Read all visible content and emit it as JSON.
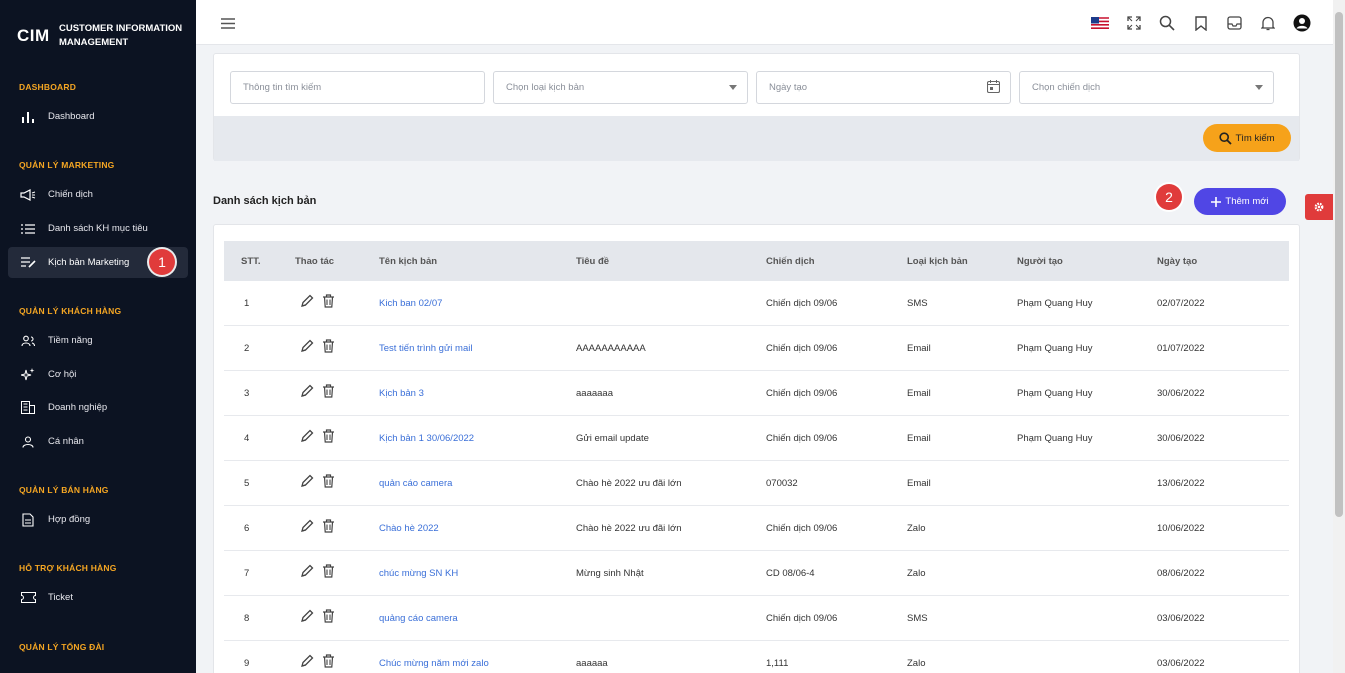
{
  "brand": {
    "mark": "CIM",
    "line1": "CUSTOMER INFORMATION",
    "line2": "MANAGEMENT"
  },
  "sidebar": {
    "sections": [
      {
        "title": "DASHBOARD",
        "items": [
          {
            "label": "Dashboard",
            "icon": "bar-chart-icon"
          }
        ]
      },
      {
        "title": "QUẢN LÝ MARKETING",
        "items": [
          {
            "label": "Chiến dịch",
            "icon": "megaphone-icon"
          },
          {
            "label": "Danh sách KH mục tiêu",
            "icon": "list-icon"
          },
          {
            "label": "Kịch bản Marketing",
            "icon": "edit-list-icon",
            "active": true
          }
        ]
      },
      {
        "title": "QUẢN LÝ KHÁCH HÀNG",
        "items": [
          {
            "label": "Tiềm năng",
            "icon": "users-icon"
          },
          {
            "label": "Cơ hội",
            "icon": "sparkle-icon"
          },
          {
            "label": "Doanh nghiệp",
            "icon": "building-icon"
          },
          {
            "label": "Cá nhân",
            "icon": "user-icon"
          }
        ]
      },
      {
        "title": "QUẢN LÝ BÁN HÀNG",
        "items": [
          {
            "label": "Hợp đồng",
            "icon": "document-icon"
          }
        ]
      },
      {
        "title": "HỖ TRỢ KHÁCH HÀNG",
        "items": [
          {
            "label": "Ticket",
            "icon": "ticket-icon"
          }
        ]
      },
      {
        "title": "QUẢN LÝ TỔNG ĐÀI",
        "items": []
      }
    ]
  },
  "callouts": {
    "one": "1",
    "two": "2"
  },
  "filters": {
    "search_placeholder": "Thông tin tìm kiếm",
    "type_placeholder": "Chọn loại kịch bản",
    "date_placeholder": "Ngày tạo",
    "campaign_placeholder": "Chọn chiến dịch",
    "search_button": "Tìm kiếm"
  },
  "list": {
    "title": "Danh sách kịch bản",
    "add_button": "Thêm mới"
  },
  "table": {
    "headers": [
      "STT.",
      "Thao tác",
      "Tên kịch bản",
      "Tiêu đề",
      "Chiến dịch",
      "Loại kịch bản",
      "Người tạo",
      "Ngày tạo"
    ],
    "rows": [
      {
        "stt": "1",
        "name": "Kich ban 02/07",
        "title": "",
        "campaign": "Chiến dịch 09/06",
        "type": "SMS",
        "creator": "Phạm Quang Huy",
        "date": "02/07/2022"
      },
      {
        "stt": "2",
        "name": "Test tiến trình gửi mail",
        "title": "AAAAAAAAAAA",
        "campaign": "Chiến dịch 09/06",
        "type": "Email",
        "creator": "Phạm Quang Huy",
        "date": "01/07/2022"
      },
      {
        "stt": "3",
        "name": "Kịch bản 3",
        "title": "aaaaaaa",
        "campaign": "Chiến dịch 09/06",
        "type": "Email",
        "creator": "Phạm Quang Huy",
        "date": "30/06/2022"
      },
      {
        "stt": "4",
        "name": "Kịch bản 1 30/06/2022",
        "title": "Gửi email update",
        "campaign": "Chiến dịch 09/06",
        "type": "Email",
        "creator": "Phạm Quang Huy",
        "date": "30/06/2022"
      },
      {
        "stt": "5",
        "name": "quản cáo camera",
        "title": "Chào hè 2022 ưu đãi lớn",
        "campaign": "070032",
        "type": "Email",
        "creator": "",
        "date": "13/06/2022"
      },
      {
        "stt": "6",
        "name": "Chào hè 2022",
        "title": "Chào hè 2022 ưu đãi lớn",
        "campaign": "Chiến dịch 09/06",
        "type": "Zalo",
        "creator": "",
        "date": "10/06/2022"
      },
      {
        "stt": "7",
        "name": "chúc mừng SN KH",
        "title": "Mừng sinh Nhật",
        "campaign": "CD 08/06-4",
        "type": "Zalo",
        "creator": "",
        "date": "08/06/2022"
      },
      {
        "stt": "8",
        "name": "quảng cáo camera",
        "title": "",
        "campaign": "Chiến dịch 09/06",
        "type": "SMS",
        "creator": "",
        "date": "03/06/2022"
      },
      {
        "stt": "9",
        "name": "Chúc mừng năm mới zalo",
        "title": "aaaaaa",
        "campaign": "1,111",
        "type": "Zalo",
        "creator": "",
        "date": "03/06/2022"
      }
    ]
  },
  "colors": {
    "sidebar_bg": "#0c1322",
    "section_title": "#f5a623",
    "primary": "#5046e5",
    "search_btn": "#f6a21a",
    "link": "#3a6fd8",
    "badge": "#e03b3b"
  }
}
